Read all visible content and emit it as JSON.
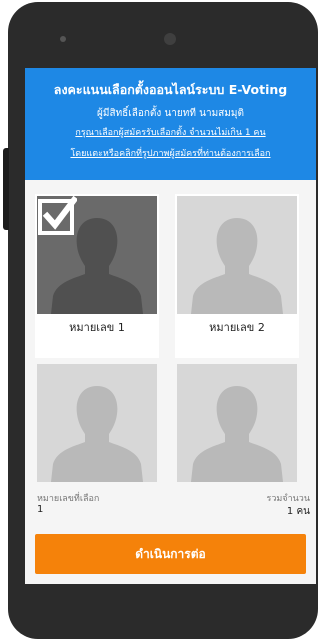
{
  "header": {
    "title": "ลงคะแนนเลือกตั้งออนไลน์ระบบ E-Voting",
    "voter": "ผู้มีสิทธิ์เลือกตั้ง นายทที นามสมมุติ",
    "instruction_line1": "กรุณาเลือกผู้สมัครรับเลือกตั้ง จำนวนไม่เกิน 1 คน",
    "instruction_line2": "โดยแตะหรือคลิกที่รูปภาพผู้สมัครที่ท่านต้องการเลือก"
  },
  "candidates": [
    {
      "label": "หมายเลข 1",
      "selected": true
    },
    {
      "label": "หมายเลข 2",
      "selected": false
    },
    {
      "label": "",
      "selected": false
    },
    {
      "label": "",
      "selected": false
    }
  ],
  "summary": {
    "selected_label": "หมายเลขที่เลือก",
    "selected_value": "1",
    "total_label": "รวมจำนวน",
    "total_value": "1 คน"
  },
  "continue_label": "ดำเนินการต่อ",
  "colors": {
    "header_bg": "#1e88e5",
    "button_bg": "#f5820a",
    "selected_photo_bg": "#6a6a6a"
  }
}
